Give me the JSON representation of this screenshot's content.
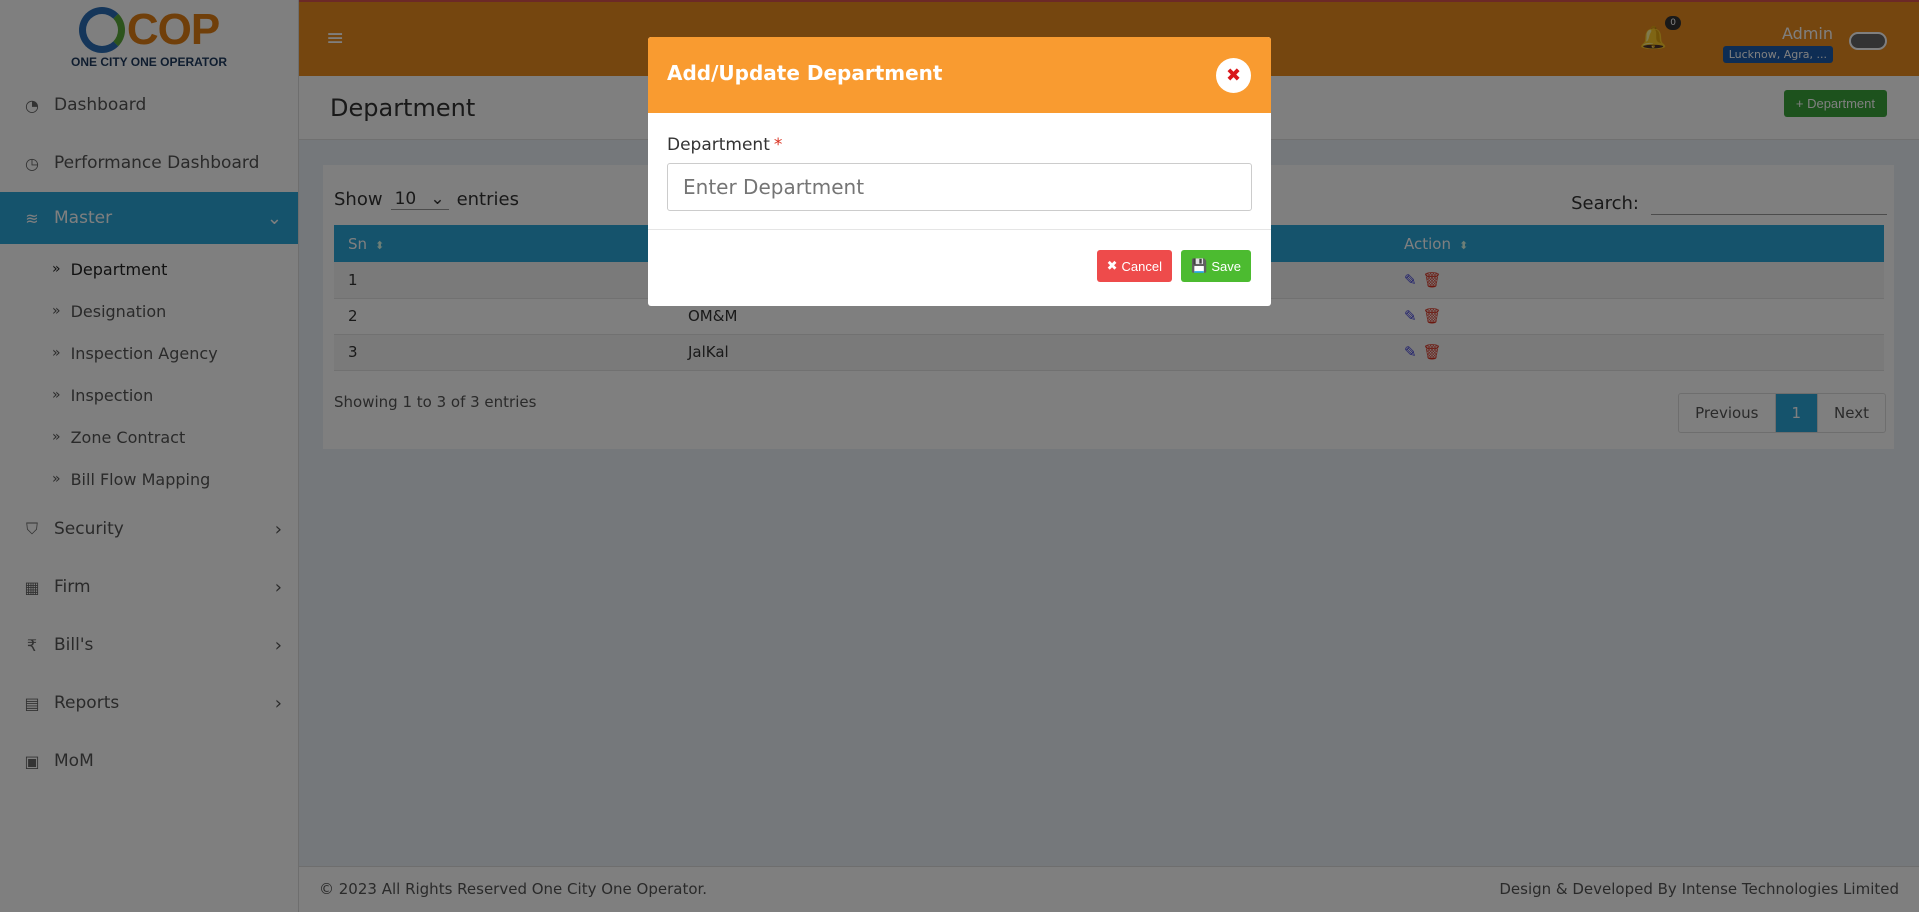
{
  "logo": {
    "text": "COP",
    "subtitle": "ONE CITY ONE OPERATOR"
  },
  "header": {
    "admin_name": "Admin",
    "admin_location": "Lucknow, Agra, ...",
    "notification_count": "0"
  },
  "sidebar": {
    "items": [
      {
        "label": "Dashboard",
        "icon": "dashboard-icon"
      },
      {
        "label": "Performance Dashboard",
        "icon": "gauge-icon"
      },
      {
        "label": "Master",
        "icon": "layers-icon"
      },
      {
        "label": "Security",
        "icon": "shield-icon"
      },
      {
        "label": "Firm",
        "icon": "building-icon"
      },
      {
        "label": "Bill's",
        "icon": "rupee-icon"
      },
      {
        "label": "Reports",
        "icon": "report-icon"
      },
      {
        "label": "MoM",
        "icon": "calendar-icon"
      }
    ],
    "master_sub": [
      {
        "label": "Department"
      },
      {
        "label": "Designation"
      },
      {
        "label": "Inspection Agency"
      },
      {
        "label": "Inspection"
      },
      {
        "label": "Zone Contract"
      },
      {
        "label": "Bill Flow Mapping"
      }
    ]
  },
  "page": {
    "title": "Department",
    "add_button": "+ Department"
  },
  "table": {
    "show_label": "Show",
    "entries_value": "10",
    "entries_label": "entries",
    "search_label": "Search:",
    "columns": [
      "Sn",
      "",
      "Action"
    ],
    "rows": [
      {
        "sn": "1",
        "name": ""
      },
      {
        "sn": "2",
        "name": "OM&M"
      },
      {
        "sn": "3",
        "name": "JalKal"
      }
    ],
    "info": "Showing 1 to 3 of 3 entries",
    "pager": {
      "previous": "Previous",
      "current": "1",
      "next": "Next"
    }
  },
  "footer": {
    "left": "© 2023 All Rights Reserved One City One Operator.",
    "right": "Design & Developed By Intense Technologies Limited"
  },
  "modal": {
    "title": "Add/Update Department",
    "field_label": "Department",
    "required_mark": "*",
    "placeholder": "Enter Department",
    "cancel_label": "Cancel",
    "save_label": "Save"
  }
}
